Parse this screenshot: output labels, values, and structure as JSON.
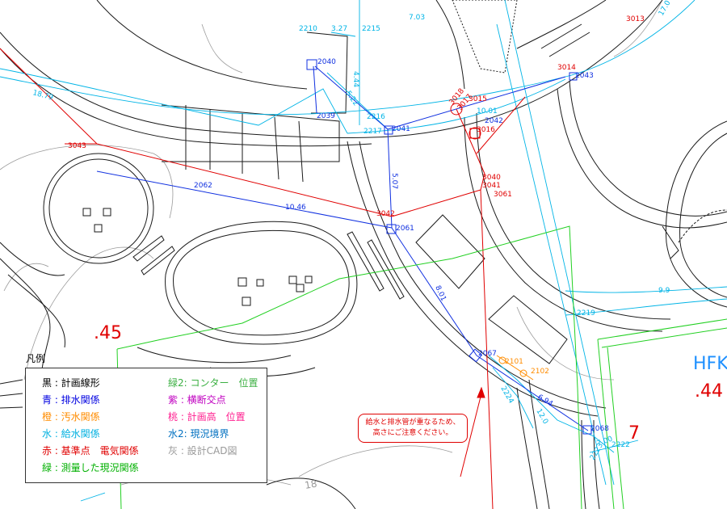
{
  "legend": {
    "title": "凡例",
    "left": [
      {
        "text": "黒 : 計画線形",
        "color": "#000000"
      },
      {
        "text": "青 : 排水関係",
        "color": "#0000e0"
      },
      {
        "text": "橙 : 汚水関係",
        "color": "#ff8c00"
      },
      {
        "text": "水 : 給水関係",
        "color": "#00b0e0"
      },
      {
        "text": "赤 : 基準点　電気関係",
        "color": "#e00000"
      },
      {
        "text": "緑 : 測量した現況関係",
        "color": "#00b000"
      }
    ],
    "right": [
      {
        "text": "緑2: コンター　位置",
        "color": "#3cb043"
      },
      {
        "text": "紫 : 横断交点",
        "color": "#c000c0"
      },
      {
        "text": "桃 : 計画高　位置",
        "color": "#ff2090"
      },
      {
        "text": "水2: 現況境界",
        "color": "#0070c0"
      },
      {
        "text": "灰 : 設計CAD図",
        "color": "#999999"
      }
    ]
  },
  "note": {
    "line1": "給水と排水管が重なるため、",
    "line2": "高さにご注意ください。"
  },
  "marks": {
    "n45": ".45",
    "n44": ".44",
    "n7": "7",
    "hfk": "HFK"
  },
  "labels": {
    "red": [
      "3043",
      "3042",
      "3040",
      "3041",
      "3061",
      "3018",
      "3017",
      "3015",
      "3016",
      "3014",
      "3013",
      "10.46",
      "18.79"
    ],
    "blue": [
      "2040",
      "2039",
      "2041",
      "2042",
      "2043",
      "2061",
      "2062",
      "2067",
      "2068",
      "5.07",
      "8.01",
      "6.94"
    ],
    "cyan": [
      "2210",
      "2215",
      "2216",
      "2217",
      "2219",
      "2222",
      "2223",
      "2224",
      "3.27",
      "7.03",
      "4.44",
      "5.22",
      "10.01",
      "9.9",
      "7.00",
      "12.0",
      "17.0"
    ],
    "orange": [
      "2101",
      "2102"
    ],
    "gray": [
      "18"
    ]
  }
}
